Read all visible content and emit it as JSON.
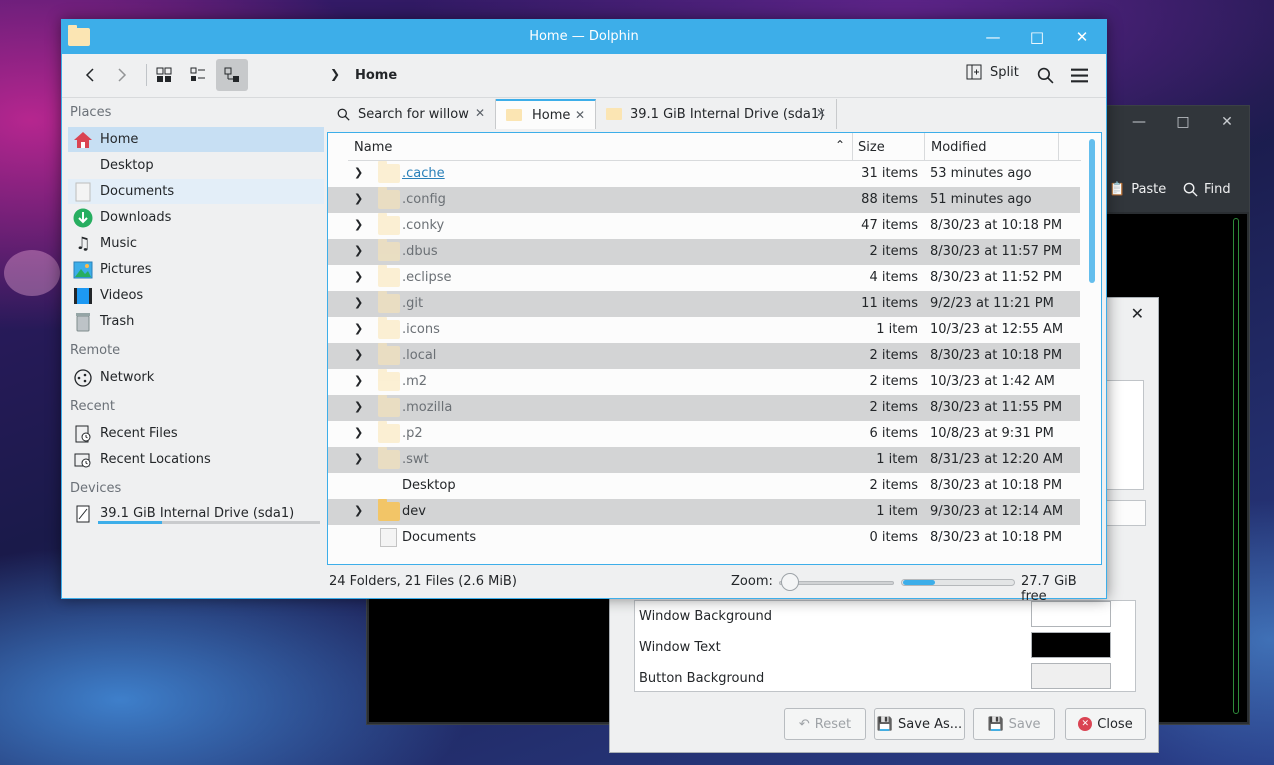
{
  "window": {
    "title": "Home — Dolphin"
  },
  "toolbar": {
    "breadcrumb": "Home",
    "split_label": "Split"
  },
  "sidebar": {
    "sections": [
      {
        "header": "Places",
        "items": [
          {
            "label": "Home",
            "icon": "home-icon"
          },
          {
            "label": "Desktop",
            "icon": "desktop-icon"
          },
          {
            "label": "Documents",
            "icon": "documents-icon"
          },
          {
            "label": "Downloads",
            "icon": "downloads-icon"
          },
          {
            "label": "Music",
            "icon": "music-icon"
          },
          {
            "label": "Pictures",
            "icon": "pictures-icon"
          },
          {
            "label": "Videos",
            "icon": "videos-icon"
          },
          {
            "label": "Trash",
            "icon": "trash-icon"
          }
        ]
      },
      {
        "header": "Remote",
        "items": [
          {
            "label": "Network",
            "icon": "network-icon"
          }
        ]
      },
      {
        "header": "Recent",
        "items": [
          {
            "label": "Recent Files",
            "icon": "recent-files-icon"
          },
          {
            "label": "Recent Locations",
            "icon": "recent-locations-icon"
          }
        ]
      },
      {
        "header": "Devices",
        "items": [
          {
            "label": "39.1 GiB Internal Drive (sda1)",
            "icon": "drive-icon",
            "usage_fraction": 0.29
          }
        ]
      }
    ]
  },
  "tabs": [
    {
      "label": "Search for willow",
      "icon": "search-icon"
    },
    {
      "label": "Home",
      "icon": "folder-icon",
      "active": true
    },
    {
      "label": "39.1 GiB Internal Drive (sda1)",
      "icon": "folder-icon"
    }
  ],
  "table": {
    "columns": {
      "name": "Name",
      "size": "Size",
      "modified": "Modified"
    },
    "rows": [
      {
        "name": ".cache",
        "size": "31 items",
        "modified": "53 minutes ago"
      },
      {
        "name": ".config",
        "size": "88 items",
        "modified": "51 minutes ago"
      },
      {
        "name": ".conky",
        "size": "47 items",
        "modified": "8/30/23 at 10:18 PM"
      },
      {
        "name": ".dbus",
        "size": "2 items",
        "modified": "8/30/23 at 11:57 PM"
      },
      {
        "name": ".eclipse",
        "size": "4 items",
        "modified": "8/30/23 at 11:52 PM"
      },
      {
        "name": ".git",
        "size": "11 items",
        "modified": "9/2/23 at 11:21 PM"
      },
      {
        "name": ".icons",
        "size": "1 item",
        "modified": "10/3/23 at 12:55 AM"
      },
      {
        "name": ".local",
        "size": "2 items",
        "modified": "8/30/23 at 10:18 PM"
      },
      {
        "name": ".m2",
        "size": "2 items",
        "modified": "10/3/23 at 1:42 AM"
      },
      {
        "name": ".mozilla",
        "size": "2 items",
        "modified": "8/30/23 at 11:55 PM"
      },
      {
        "name": ".p2",
        "size": "6 items",
        "modified": "10/8/23 at 9:31 PM"
      },
      {
        "name": ".swt",
        "size": "1 item",
        "modified": "8/31/23 at 12:20 AM"
      },
      {
        "name": "Desktop",
        "size": "2 items",
        "modified": "8/30/23 at 10:18 PM"
      },
      {
        "name": "dev",
        "size": "1 item",
        "modified": "9/30/23 at 12:14 AM"
      },
      {
        "name": "Documents",
        "size": "0 items",
        "modified": "8/30/23 at 10:18 PM"
      }
    ]
  },
  "status": {
    "summary": "24 Folders, 21 Files (2.6 MiB)",
    "zoom_label": "Zoom:",
    "free_space": "27.7 GiB free",
    "used_fraction": 0.29
  },
  "terminal": {
    "paste_label": "Paste",
    "find_label": "Find"
  },
  "dialog": {
    "rows": [
      {
        "label": "Window Background",
        "color": "#ffffff"
      },
      {
        "label": "Window Text",
        "color": "#000000"
      },
      {
        "label": "Button Background",
        "color": "#efefef"
      }
    ],
    "buttons": {
      "reset": "Reset",
      "save_as": "Save As...",
      "save": "Save",
      "close": "Close"
    }
  },
  "colors": {
    "accent": "#3daee9",
    "selection": "#c7dff3",
    "folder": "#fbe5b3"
  }
}
